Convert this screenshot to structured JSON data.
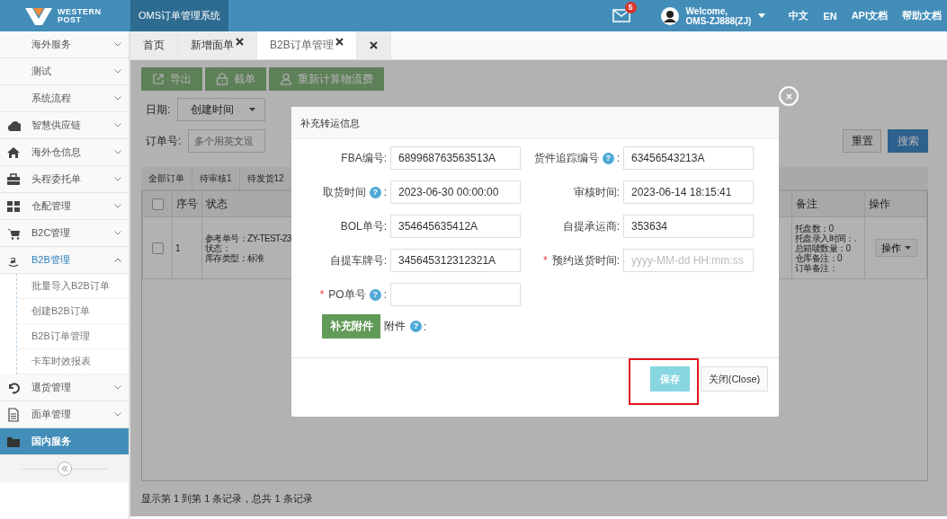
{
  "header": {
    "logo": {
      "line1": "WESTERN",
      "line2": "POST"
    },
    "system_title": "OMS订单管理系统",
    "mail_badge": "5",
    "welcome": "Welcome,",
    "user": "OMS-ZJ888(ZJ)",
    "links": [
      "中文",
      "EN",
      "API文档",
      "帮助文档"
    ]
  },
  "sidebar": {
    "items": [
      {
        "label": "海外服务",
        "expanded": false,
        "selected": false
      },
      {
        "label": "测试",
        "expanded": false,
        "selected": false
      },
      {
        "label": "系统流程",
        "expanded": false,
        "selected": false
      },
      {
        "label": "智慧供应链",
        "expanded": false,
        "selected": false
      },
      {
        "label": "海外仓信息",
        "expanded": false,
        "selected": false
      },
      {
        "label": "头程委托单",
        "expanded": false,
        "selected": false
      },
      {
        "label": "仓配管理",
        "expanded": false,
        "selected": false
      },
      {
        "label": "B2C管理",
        "expanded": false,
        "selected": false
      },
      {
        "label": "B2B管理",
        "expanded": true,
        "selected": false,
        "children": [
          {
            "label": "批量导入B2B订单",
            "selected": false
          },
          {
            "label": "创建B2B订单",
            "selected": false
          },
          {
            "label": "B2B订单管理",
            "selected": false
          },
          {
            "label": "卡车时效报表",
            "selected": false
          }
        ]
      },
      {
        "label": "退货管理",
        "expanded": false,
        "selected": false
      },
      {
        "label": "面单管理",
        "expanded": false,
        "selected": false
      },
      {
        "label": "国内服务",
        "selected": true
      }
    ]
  },
  "page_tabs": [
    {
      "kind": "text",
      "label": "首页",
      "selected": false,
      "closable": false
    },
    {
      "kind": "text",
      "label": "新增面单",
      "selected": false,
      "closable": true
    },
    {
      "kind": "text",
      "label": "B2B订单管理",
      "selected": true,
      "closable": true
    },
    {
      "kind": "close-all",
      "selected": false
    }
  ],
  "toolbar": [
    {
      "label": "导出"
    },
    {
      "label": "截单"
    },
    {
      "label": "重新计算物流费"
    }
  ],
  "filters": {
    "date_label": "日期:",
    "date_select": "创建时间",
    "order_label": "订单号:",
    "order_placeholder": "多个用英文逗"
  },
  "filter_buttons": [
    {
      "label": "重置",
      "kind": "default"
    },
    {
      "label": "搜索",
      "kind": "primary"
    }
  ],
  "status_tabs": [
    {
      "label": "全部订单"
    },
    {
      "label": "待审核1"
    },
    {
      "label": "待发货12"
    }
  ],
  "table": {
    "columns": [
      {
        "kind": "checkbox",
        "checked": false
      },
      {
        "kind": "text",
        "label": "序号"
      },
      {
        "kind": "text",
        "label": "状态"
      },
      {
        "kind": "blank"
      },
      {
        "kind": "text",
        "label": "备注"
      },
      {
        "kind": "text",
        "label": "操作"
      }
    ],
    "rows": [
      {
        "checked": false,
        "number": "1",
        "status_lines": [
          "参考单号：ZY-TEST-23",
          "状态：",
          "库存类型：标准"
        ],
        "remark_lines": [
          "托盘数：0",
          "托盘录入时间：.",
          "总箱唛数量：0",
          "仓库备注：0",
          "订单备注："
        ],
        "action": "操作"
      }
    ]
  },
  "footer_text": "显示第 1 到第 1 条记录，总共 1 条记录",
  "modal": {
    "title": "补充转运信息",
    "fields": [
      {
        "label": "FBA编号:",
        "value": "689968763563513A"
      },
      {
        "label": "货件追踪编号",
        "help": "?",
        "suffix": ":",
        "value": "63456543213A"
      },
      {
        "label": "取货时间",
        "help": "?",
        "suffix": ":",
        "value": "2023-06-30 00:00:00"
      },
      {
        "label": "审核时间:",
        "value": "2023-06-14 18:15:41"
      },
      {
        "label": "BOL单号:",
        "value": "354645635412A"
      },
      {
        "label": "自提承运商:",
        "value": "353634"
      },
      {
        "label": "自提车牌号:",
        "value": "345645312312321A"
      },
      {
        "label": "预约送货时间:",
        "required_mark": "*",
        "placeholder": "yyyy-MM-dd HH:mm:ss"
      },
      {
        "label": "PO单号",
        "required_mark": "*",
        "help": "?",
        "suffix": ":"
      }
    ],
    "attach_button": "补充附件",
    "attach_label": "附件",
    "attach_help": "?",
    "attach_suffix": ":",
    "buttons": [
      {
        "label": "保存",
        "kind": "primary",
        "highlighted": true
      },
      {
        "label": "关闭(Close)",
        "kind": "default",
        "highlighted": false
      }
    ]
  }
}
